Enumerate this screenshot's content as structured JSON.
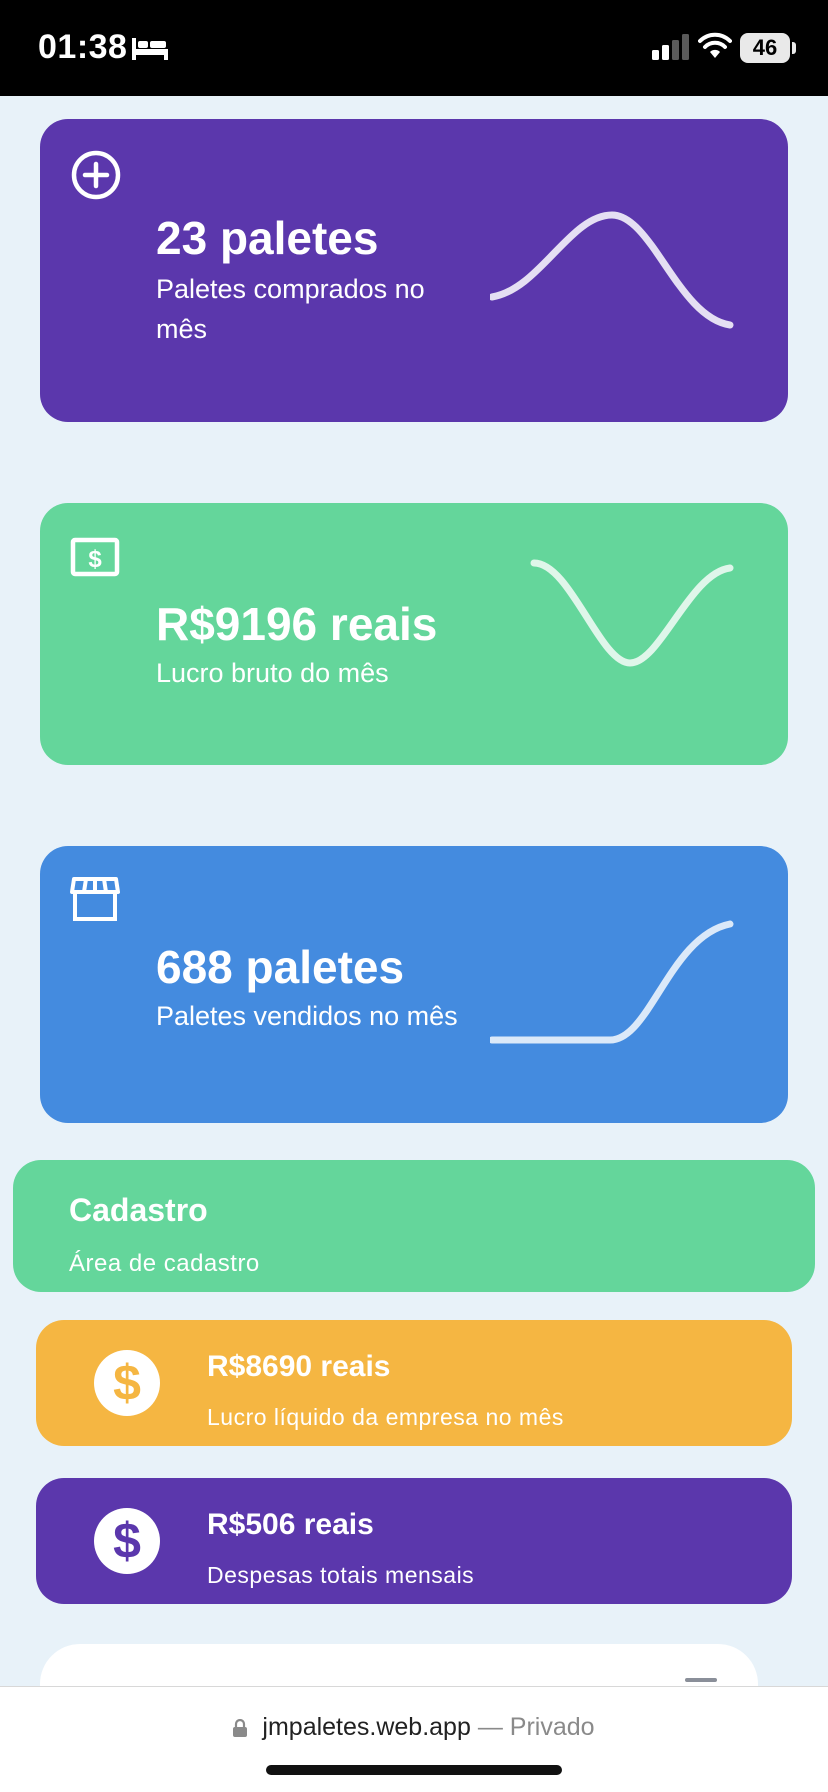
{
  "status_bar": {
    "time": "01:38",
    "battery": "46"
  },
  "cards": [
    {
      "value": "23 paletes",
      "label": "Paletes comprados no mês",
      "icon": "plus-circle-icon",
      "color": "#5b37ac"
    },
    {
      "value": "R$9196 reais",
      "label": "Lucro bruto do mês",
      "icon": "money-bill-icon",
      "color": "#64d69b"
    },
    {
      "value": "688 paletes",
      "label": "Paletes vendidos no mês",
      "icon": "store-icon",
      "color": "#448bdf"
    }
  ],
  "cadastro": {
    "title": "Cadastro",
    "subtitle": "Área de cadastro"
  },
  "summary": [
    {
      "value": "R$8690 reais",
      "label": "Lucro líquido da empresa no mês",
      "icon": "dollar-coin-icon",
      "color": "#f5b642"
    },
    {
      "value": "R$506 reais",
      "label": "Despesas totais mensais",
      "icon": "dollar-coin-icon",
      "color": "#5b37ac"
    }
  ],
  "browser": {
    "domain": "jmpaletes.web.app",
    "separator": "—",
    "mode": "Privado"
  }
}
